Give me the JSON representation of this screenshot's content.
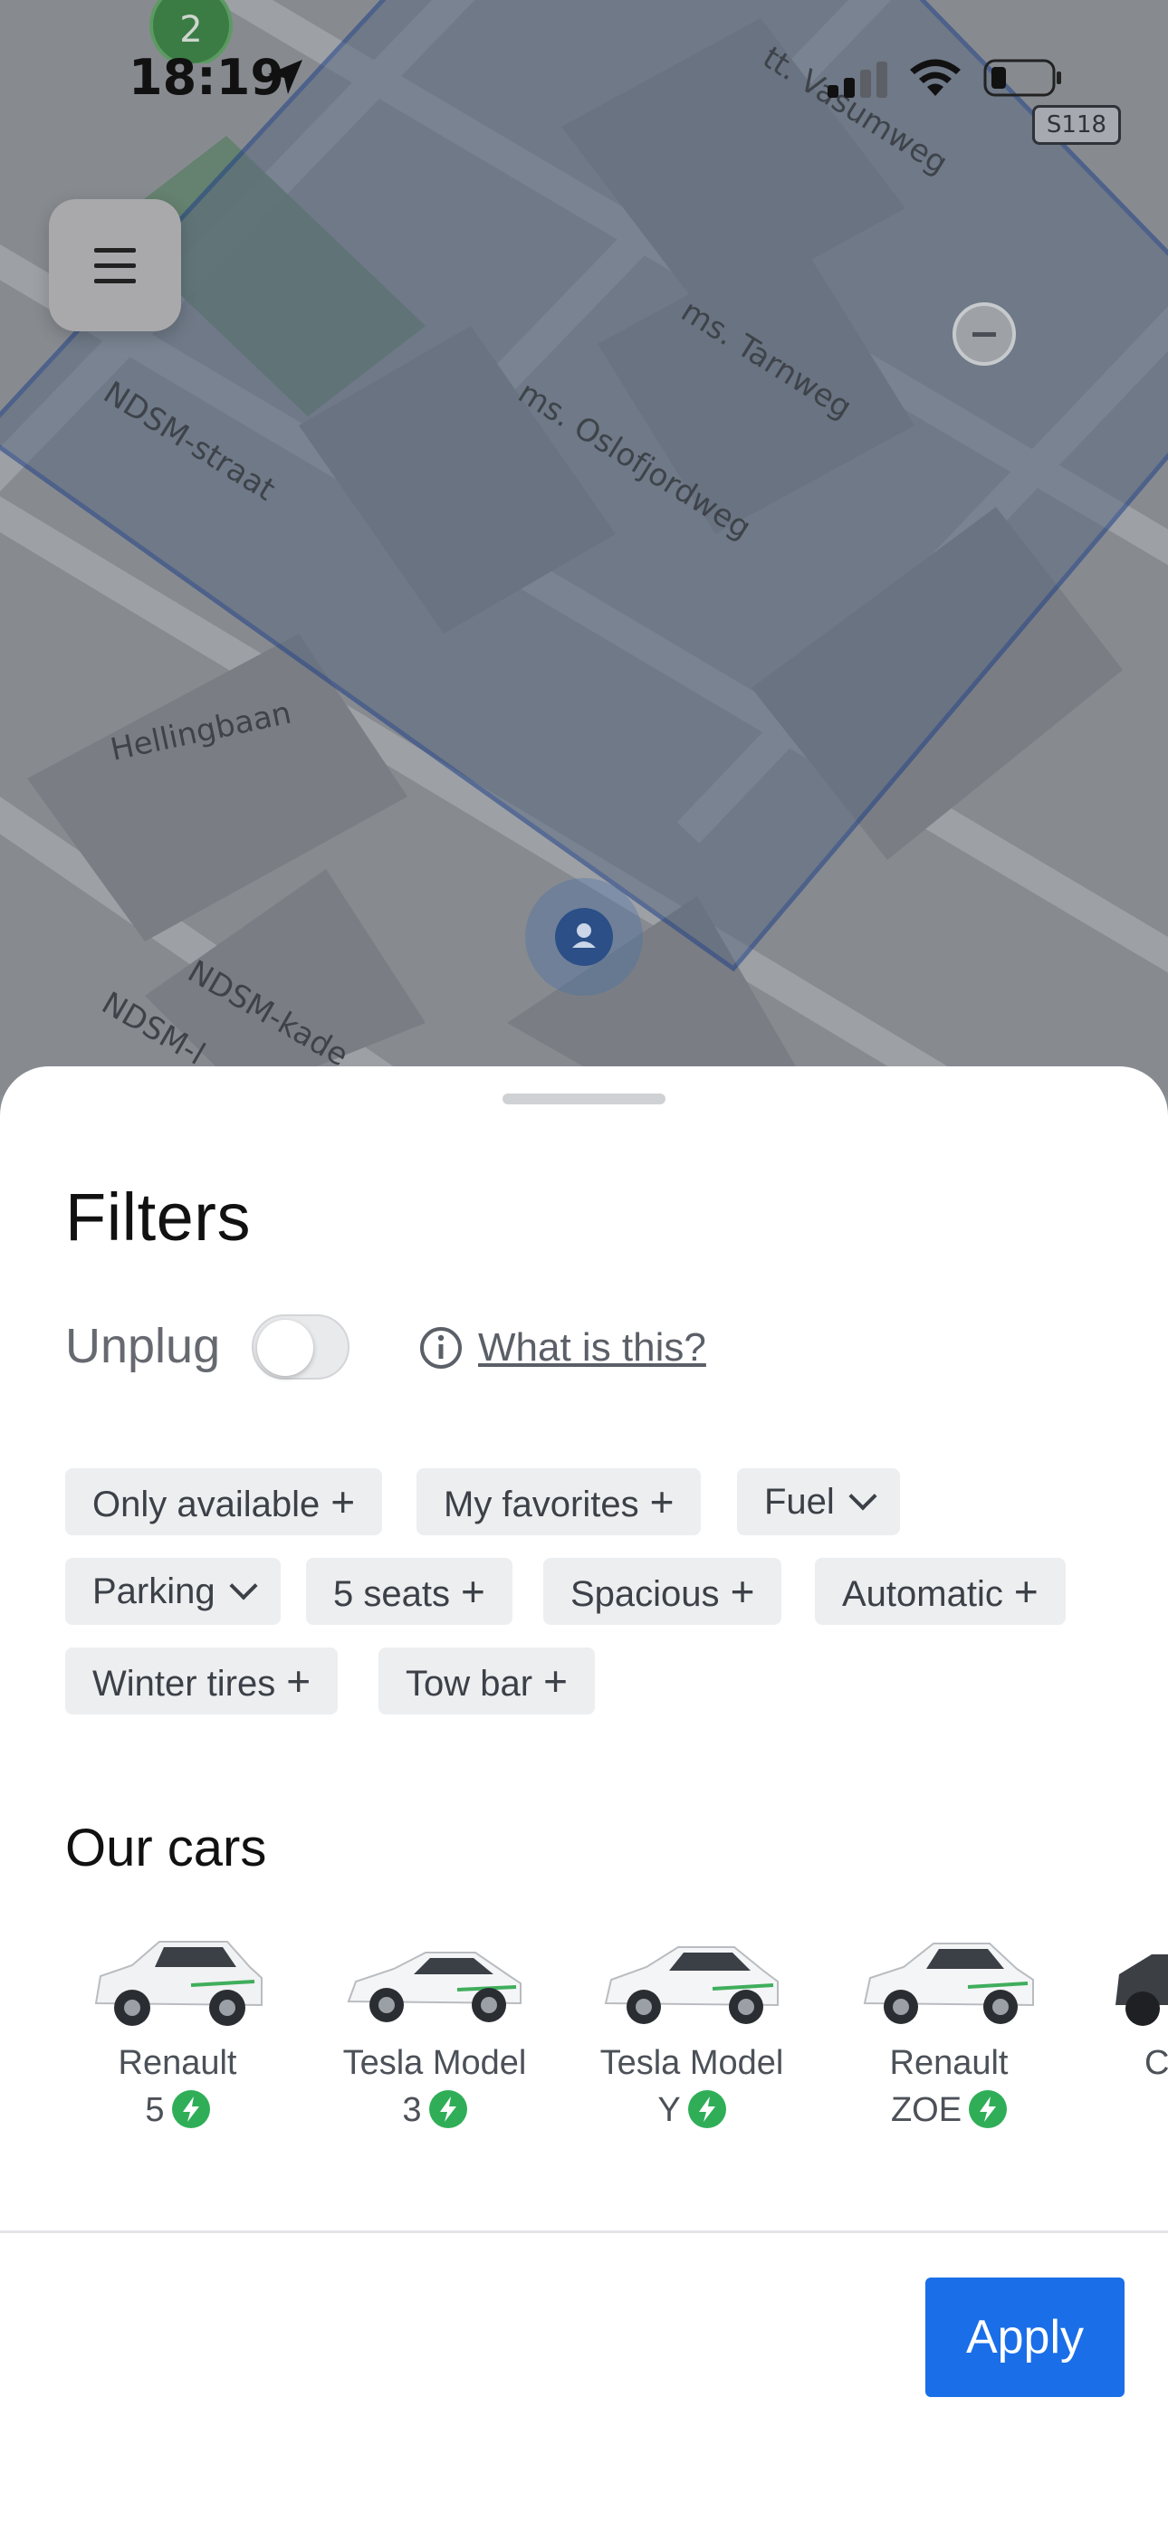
{
  "status_bar": {
    "time": "18:19",
    "road_badge": "S118",
    "cluster_count": "2"
  },
  "map": {
    "street_labels": [
      "tt. Vasumweg",
      "ms. Tarnweg",
      "NDSM-straat",
      "ms. Oslofjordweg",
      "Hellingbaan",
      "NDSM-kade",
      "NDSM-l"
    ],
    "colors": {
      "zone_border": "#1f3f86",
      "zone_fill": "#6b7482"
    }
  },
  "sheet": {
    "title": "Filters",
    "unplug_label": "Unplug",
    "unplug_on": false,
    "what_link": "What is this?",
    "chips": [
      {
        "label": "Only available",
        "icon": "+"
      },
      {
        "label": "My favorites",
        "icon": "+"
      },
      {
        "label": "Fuel",
        "icon": "chevron-down"
      },
      {
        "label": "Parking",
        "icon": "chevron-down"
      },
      {
        "label": "5 seats",
        "icon": "+"
      },
      {
        "label": "Spacious",
        "icon": "+"
      },
      {
        "label": "Automatic",
        "icon": "+"
      },
      {
        "label": "Winter tires",
        "icon": "+"
      },
      {
        "label": "Tow bar",
        "icon": "+"
      }
    ],
    "cars_title": "Our cars",
    "cars": [
      {
        "name": "Renault",
        "model": "5",
        "electric": true
      },
      {
        "name": "Tesla Model",
        "model": "3",
        "electric": true
      },
      {
        "name": "Tesla Model",
        "model": "Y",
        "electric": true
      },
      {
        "name": "Renault",
        "model": "ZOE",
        "electric": true
      },
      {
        "name": "C",
        "model": "",
        "electric": false
      }
    ],
    "apply_label": "Apply",
    "colors": {
      "primary": "#1a6ee8",
      "electric": "#2fae57"
    }
  }
}
